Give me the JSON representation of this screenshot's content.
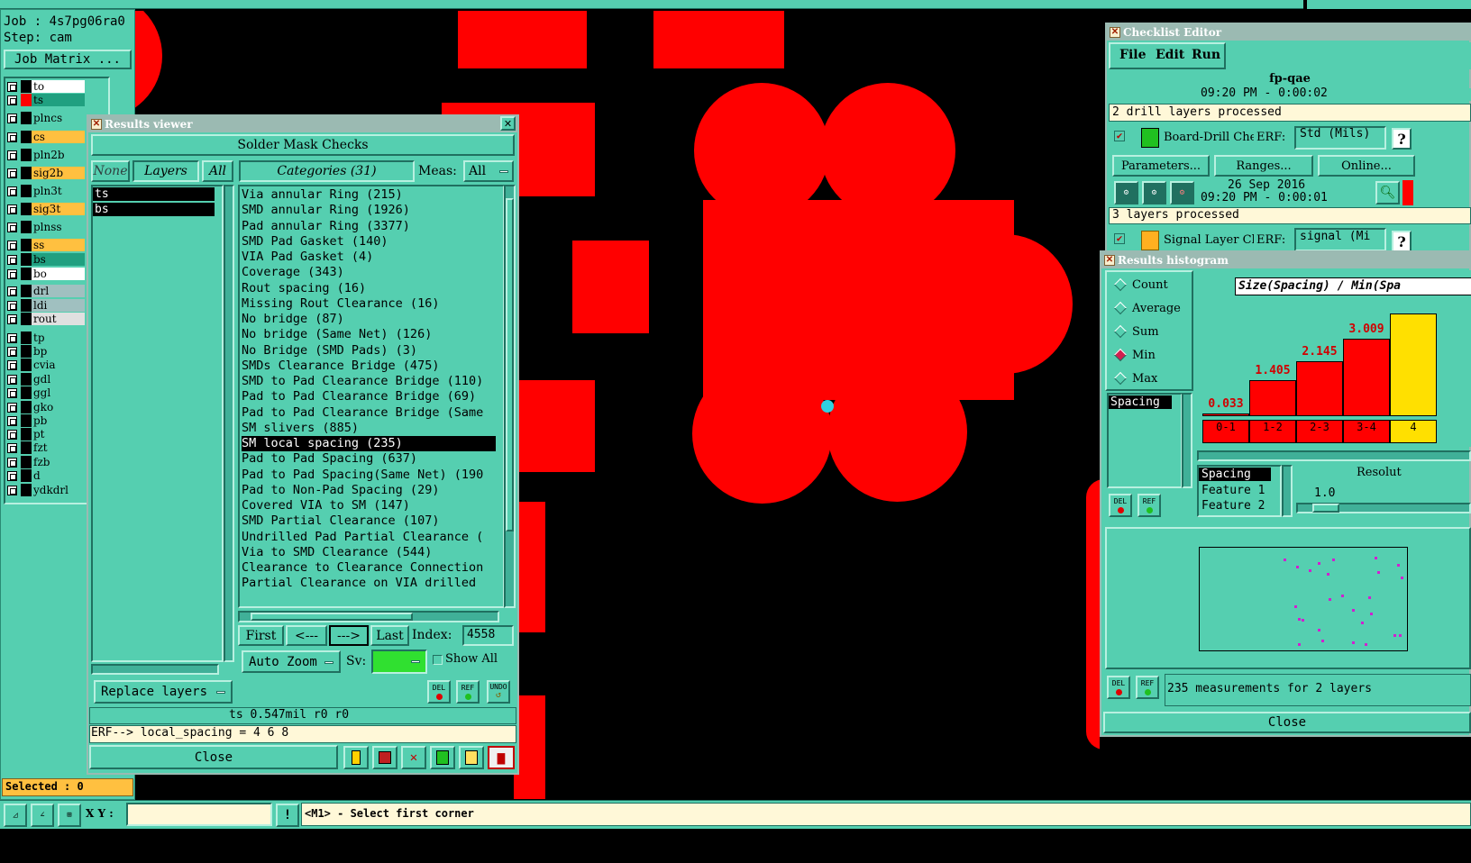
{
  "main": {
    "job_label": "Job : 4s7pg06ra0",
    "step_label": "Step: cam",
    "job_matrix_button": "Job Matrix ...",
    "selected_label": "Selected : 0",
    "xy_label": "X Y :",
    "xy_value": "",
    "prompt": "<M1> - Select first corner",
    "layers": [
      {
        "name": "to",
        "color": "#ffffff"
      },
      {
        "name": "ts",
        "color": "#20a080"
      },
      {
        "name": "plncs",
        "color": "#55cfb0"
      },
      {
        "name": "cs",
        "color": "#ffc040"
      },
      {
        "name": "pln2b",
        "color": "#55cfb0"
      },
      {
        "name": "sig2b",
        "color": "#ffc040"
      },
      {
        "name": "pln3t",
        "color": "#55cfb0"
      },
      {
        "name": "sig3t",
        "color": "#ffc040"
      },
      {
        "name": "plnss",
        "color": "#55cfb0"
      },
      {
        "name": "ss",
        "color": "#ffc040"
      },
      {
        "name": "bs",
        "color": "#20a080"
      },
      {
        "name": "bo",
        "color": "#ffffff"
      },
      {
        "name": "drl",
        "color": "#a0c0c0"
      },
      {
        "name": "ldi",
        "color": "#a0c0c0"
      },
      {
        "name": "rout",
        "color": "#e0e0e0"
      },
      {
        "name": "tp",
        "color": "#55cfb0"
      },
      {
        "name": "bp",
        "color": "#55cfb0"
      },
      {
        "name": "cvia",
        "color": "#55cfb0"
      },
      {
        "name": "gdl",
        "color": "#55cfb0"
      },
      {
        "name": "ggl",
        "color": "#55cfb0"
      },
      {
        "name": "gko",
        "color": "#55cfb0"
      },
      {
        "name": "pb",
        "color": "#55cfb0"
      },
      {
        "name": "pt",
        "color": "#55cfb0"
      },
      {
        "name": "fzt",
        "color": "#55cfb0"
      },
      {
        "name": "fzb",
        "color": "#55cfb0"
      },
      {
        "name": "d",
        "color": "#55cfb0"
      },
      {
        "name": "ydkdrl",
        "color": "#55cfb0"
      }
    ]
  },
  "results_viewer": {
    "title": "Results viewer",
    "header": "Solder Mask Checks",
    "none_button": "None",
    "layers_button": "Layers",
    "all_button": "All",
    "categories_button": "Categories (31)",
    "meas_label": "Meas:",
    "meas_value": "All",
    "layer_list": [
      "ts",
      "bs"
    ],
    "categories": [
      "Via annular Ring (215)",
      "SMD annular Ring (1926)",
      "Pad annular Ring (3377)",
      "SMD Pad Gasket (140)",
      "VIA Pad Gasket (4)",
      "Coverage (343)",
      "Rout spacing (16)",
      "Missing Rout Clearance (16)",
      "No bridge (87)",
      "No bridge (Same Net) (126)",
      "No Bridge (SMD Pads) (3)",
      "SMDs Clearance Bridge (475)",
      "SMD to Pad Clearance Bridge (110)",
      "Pad to Pad Clearance Bridge (69)",
      "Pad to Pad Clearance Bridge (Same",
      "SM slivers (885)",
      "SM local spacing (235)",
      "Pad to Pad Spacing (637)",
      "Pad to Pad Spacing(Same Net) (190",
      "Pad to Non-Pad Spacing (29)",
      "Covered VIA to SM (147)",
      "SMD Partial Clearance (107)",
      "Undrilled Pad Partial Clearance (",
      "Via to SMD Clearance (544)",
      "Clearance to Clearance Connection",
      "Partial Clearance on VIA drilled"
    ],
    "selected_category": "SM local spacing (235)",
    "first_button": "First",
    "prev_button": "<---",
    "next_button": "--->",
    "last_button": "Last",
    "index_label": "Index:",
    "index_value": "4558",
    "auto_zoom": "Auto Zoom",
    "sv_label": "Sv:",
    "show_all": "Show All",
    "replace_layers": "Replace layers",
    "del_label": "DEL",
    "ref_label": "REF",
    "undo_label": "UNDO",
    "status_line": "ts 0.547mil   r0   r0",
    "erf_line": "ERF--> local_spacing = 4 6 8",
    "close_button": "Close"
  },
  "checklist_editor": {
    "title": "Checklist Editor",
    "menu": [
      "File",
      "Edit",
      "Run"
    ],
    "checklist_name": "fp-qae",
    "row0_time": "09:20 PM - 0:00:02",
    "row1_status": "2 drill layers processed",
    "row2_name": "Board-Drill Che",
    "row2_erf_label": "ERF:",
    "row2_erf_value": "Std (Mils)",
    "parameters_button": "Parameters...",
    "ranges_button": "Ranges...",
    "online_button": "Online...",
    "row3_date": "26 Sep 2016",
    "row3_time": "09:20 PM - 0:00:01",
    "row4_status": "3 layers processed",
    "row5_name": "Signal Layer Ch",
    "row5_erf_label": "ERF:",
    "row5_erf_value": "signal (Mi",
    "help_label": "?"
  },
  "histogram": {
    "title": "Results histogram",
    "options": [
      "Count",
      "Average",
      "Sum",
      "Min",
      "Max"
    ],
    "selected_option": "Min",
    "list_item": "Spacing",
    "chart_title": "Size(Spacing) / Min(Spa",
    "field_list": [
      "Spacing",
      "Feature 1",
      "Feature 2"
    ],
    "resolution_label": "Resolut",
    "resolution_value": "1.0",
    "summary": "235 measurements for 2 layers",
    "close_button": "Close",
    "del_label": "DEL",
    "ref_label": "REF",
    "chart_data": {
      "type": "bar",
      "categories": [
        "0-1",
        "1-2",
        "2-3",
        "3-4",
        "4"
      ],
      "values": [
        0.033,
        1.405,
        2.145,
        3.009,
        4.0
      ],
      "value_labels": [
        "0.033",
        "1.405",
        "2.145",
        "3.009",
        ""
      ],
      "title": "Size(Spacing) / Min(Spa",
      "bar_color": "#ff0000",
      "highlight_color": "#ffe000"
    }
  },
  "colors": {
    "panel": "#55cfb0",
    "copper": "#ff0000",
    "background": "#000000",
    "titlebar": "#9bbab2"
  }
}
